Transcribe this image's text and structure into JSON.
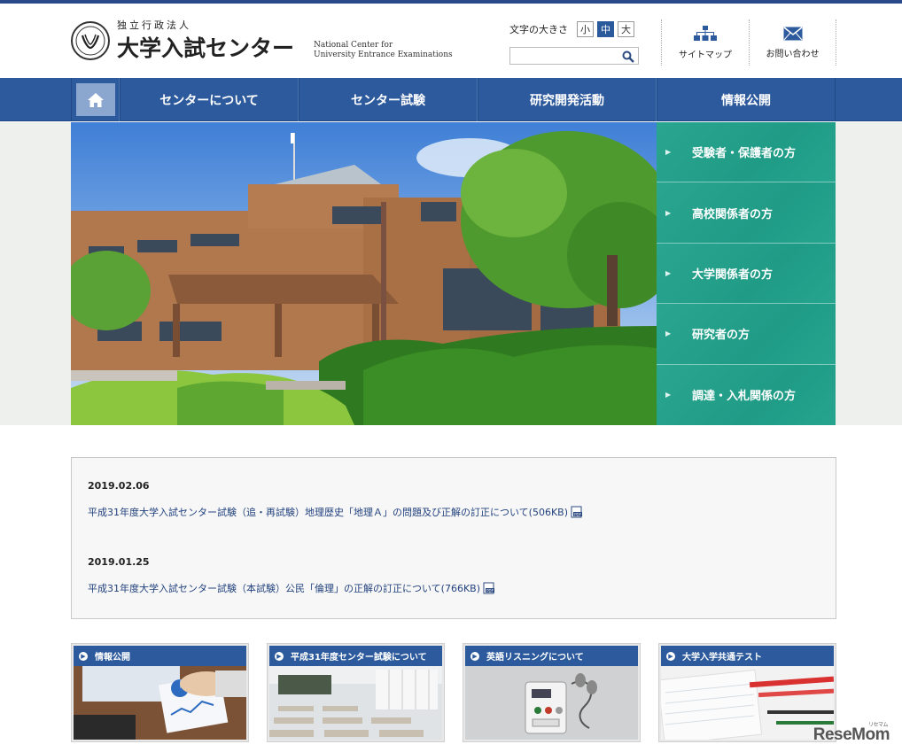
{
  "header": {
    "org_prefix": "独立行政法人",
    "org_name": "大学入試センター",
    "org_name_en_line1": "National Center for",
    "org_name_en_line2": "University Entrance Examinations",
    "font_size_label": "文字の大きさ",
    "font_size_options": [
      "小",
      "中",
      "大"
    ],
    "font_size_selected": "中",
    "search": {
      "placeholder": "",
      "value": ""
    },
    "sitemap_label": "サイトマップ",
    "contact_label": "お問い合わせ"
  },
  "nav": {
    "items": [
      "センターについて",
      "センター試験",
      "研究開発活動",
      "情報公開"
    ]
  },
  "audience": {
    "items": [
      "受験者・保護者の方",
      "高校関係者の方",
      "大学関係者の方",
      "研究者の方",
      "調達・入札関係の方"
    ]
  },
  "news": [
    {
      "date": "2019.02.06",
      "title": "平成31年度大学入試センター試験（追・再試験）地理歴史「地理Ａ」の問題及び正解の訂正について(506KB)",
      "icon": "pdf-icon"
    },
    {
      "date": "2019.01.25",
      "title": "平成31年度大学入試センター試験（本試験）公民「倫理」の正解の訂正について(766KB)",
      "icon": "pdf-icon"
    }
  ],
  "banners": [
    {
      "title": "情報公開"
    },
    {
      "title": "平成31年度センター試験について"
    },
    {
      "title": "英語リスニングについて"
    },
    {
      "title": "大学入学共通テスト"
    }
  ],
  "watermark": {
    "main": "ReseMom",
    "sub": "リセマム"
  },
  "colors": {
    "brand_blue": "#2c5a9d",
    "teal": "#1f9b86",
    "link": "#22427e"
  }
}
